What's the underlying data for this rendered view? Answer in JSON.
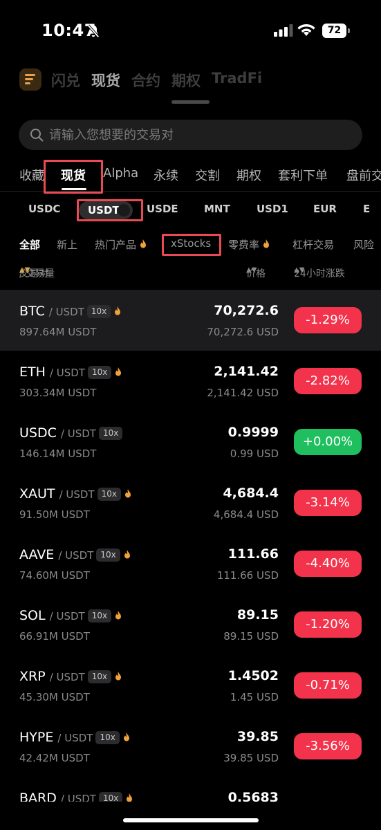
{
  "status_bar": {
    "time": "10:47",
    "battery": "72"
  },
  "top_tabs": [
    "闪兑",
    "现货",
    "合约",
    "期权",
    "TradFi"
  ],
  "top_tab_active": 1,
  "search": {
    "placeholder": "请输入您想要的交易对"
  },
  "category_tabs": [
    "收藏",
    "现货",
    "Alpha",
    "永续",
    "交割",
    "期权",
    "套利下单",
    "盘前交"
  ],
  "quote_chips": [
    "USDC",
    "USDT",
    "USDE",
    "MNT",
    "USD1",
    "EUR",
    "E"
  ],
  "sub_tabs": [
    "全部",
    "新上",
    "热门产品",
    "xStocks",
    "零费率",
    "杠杆交易",
    "风险"
  ],
  "columns": {
    "pair": "交易对",
    "volume": "/ 交易量",
    "price": "价格",
    "change": "24小时涨跌"
  },
  "rows": [
    {
      "base": "BTC",
      "quote": "/ USDT",
      "lev": "10x",
      "hot": true,
      "vol": "897.64M USDT",
      "price": "70,272.6",
      "usd": "70,272.6 USD",
      "change": "-1.29%",
      "dir": "neg"
    },
    {
      "base": "ETH",
      "quote": "/ USDT",
      "lev": "10x",
      "hot": true,
      "vol": "303.34M USDT",
      "price": "2,141.42",
      "usd": "2,141.42 USD",
      "change": "-2.82%",
      "dir": "neg"
    },
    {
      "base": "USDC",
      "quote": "/ USDT",
      "lev": "10x",
      "hot": false,
      "vol": "146.14M USDT",
      "price": "0.9999",
      "usd": "0.99 USD",
      "change": "+0.00%",
      "dir": "pos"
    },
    {
      "base": "XAUT",
      "quote": "/ USDT",
      "lev": "10x",
      "hot": true,
      "vol": "91.50M USDT",
      "price": "4,684.4",
      "usd": "4,684.4 USD",
      "change": "-3.14%",
      "dir": "neg"
    },
    {
      "base": "AAVE",
      "quote": "/ USDT",
      "lev": "10x",
      "hot": true,
      "vol": "74.60M USDT",
      "price": "111.66",
      "usd": "111.66 USD",
      "change": "-4.40%",
      "dir": "neg"
    },
    {
      "base": "SOL",
      "quote": "/ USDT",
      "lev": "10x",
      "hot": true,
      "vol": "66.91M USDT",
      "price": "89.15",
      "usd": "89.15 USD",
      "change": "-1.20%",
      "dir": "neg"
    },
    {
      "base": "XRP",
      "quote": "/ USDT",
      "lev": "10x",
      "hot": true,
      "vol": "45.30M USDT",
      "price": "1.4502",
      "usd": "1.45 USD",
      "change": "-0.71%",
      "dir": "neg"
    },
    {
      "base": "HYPE",
      "quote": "/ USDT",
      "lev": "10x",
      "hot": true,
      "vol": "42.42M USDT",
      "price": "39.85",
      "usd": "39.85 USD",
      "change": "-3.56%",
      "dir": "neg"
    },
    {
      "base": "BARD",
      "quote": "/ USDT",
      "lev": "10x",
      "hot": true,
      "vol": "",
      "price": "0.5683",
      "usd": "",
      "change": "",
      "dir": "neg"
    }
  ],
  "colors": {
    "negative": "#f2334b",
    "positive": "#1fbf5f",
    "accent": "#d4a54a",
    "highlight_box": "#e94a55"
  }
}
